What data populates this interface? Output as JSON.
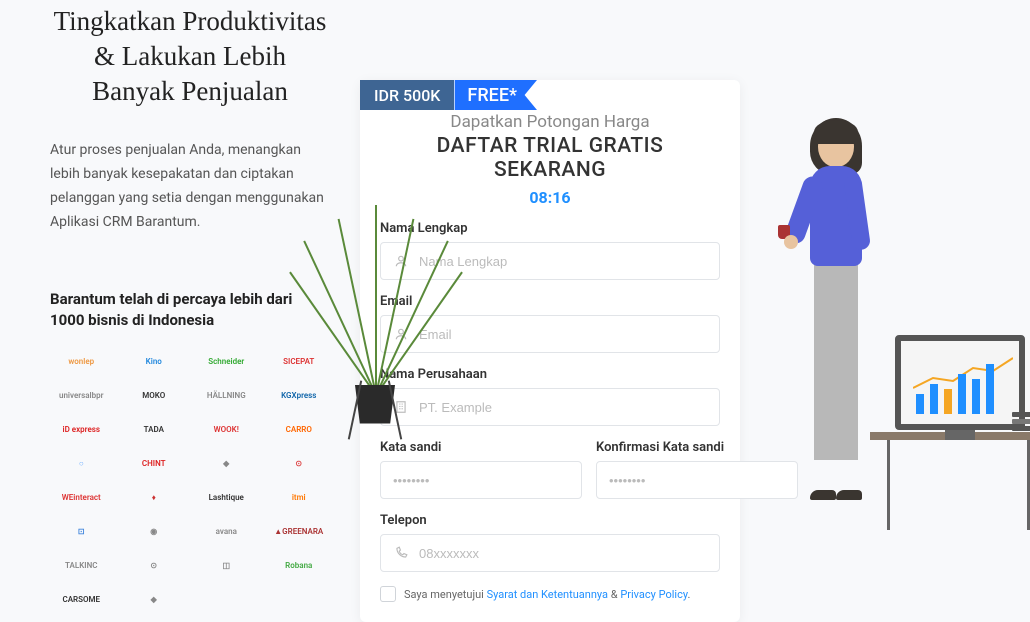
{
  "left": {
    "headline": "Tingkatkan Produktivitas & Lakukan Lebih Banyak Penjualan",
    "subtext": "Atur proses penjualan Anda, menangkan lebih banyak kesepakatan dan ciptakan pelanggan yang setia dengan menggunakan Aplikasi CRM Barantum.",
    "trusted": "Barantum telah di percaya lebih dari 1000 bisnis di Indonesia",
    "logos": [
      {
        "text": "wonlep",
        "color": "#e94"
      },
      {
        "text": "Kino",
        "color": "#28d"
      },
      {
        "text": "Schneider",
        "color": "#3a3"
      },
      {
        "text": "SICEPAT",
        "color": "#d33"
      },
      {
        "text": "universalbpr",
        "color": "#888"
      },
      {
        "text": "MOKO",
        "color": "#333"
      },
      {
        "text": "HÄLLNING",
        "color": "#888"
      },
      {
        "text": "KGXpress",
        "color": "#16a"
      },
      {
        "text": "iD express",
        "color": "#d22"
      },
      {
        "text": "TADA",
        "color": "#333"
      },
      {
        "text": "WOOK!",
        "color": "#d33"
      },
      {
        "text": "CARRO",
        "color": "#f60"
      },
      {
        "text": "○",
        "color": "#6af"
      },
      {
        "text": "CHINT",
        "color": "#d22"
      },
      {
        "text": "◆",
        "color": "#888"
      },
      {
        "text": "⊙",
        "color": "#d44"
      },
      {
        "text": "WEinteract",
        "color": "#d33"
      },
      {
        "text": "♦",
        "color": "#c33"
      },
      {
        "text": "Lashtique",
        "color": "#333"
      },
      {
        "text": "itmi",
        "color": "#f70"
      },
      {
        "text": "⊡",
        "color": "#48d"
      },
      {
        "text": "◉",
        "color": "#888"
      },
      {
        "text": "avana",
        "color": "#888"
      },
      {
        "text": "▲GREENARA",
        "color": "#a33"
      },
      {
        "text": "TALKINC",
        "color": "#888"
      },
      {
        "text": "⊙",
        "color": "#888"
      },
      {
        "text": "◫",
        "color": "#888"
      },
      {
        "text": "Robana",
        "color": "#4a4"
      },
      {
        "text": "CARSOME",
        "color": "#333"
      },
      {
        "text": "◆",
        "color": "#888"
      }
    ]
  },
  "form": {
    "price_old": "IDR 500K",
    "price_new": "FREE*",
    "subtitle": "Dapatkan Potongan Harga",
    "title": "DAFTAR TRIAL GRATIS SEKARANG",
    "timer": "08:16",
    "fields": {
      "name_label": "Nama Lengkap",
      "name_placeholder": "Nama Lengkap",
      "email_label": "Email",
      "email_placeholder": "Email",
      "company_label": "Nama Perusahaan",
      "company_placeholder": "PT. Example",
      "password_label": "Kata sandi",
      "password_placeholder": "••••••••",
      "confirm_label": "Konfirmasi Kata sandi",
      "confirm_placeholder": "••••••••",
      "phone_label": "Telepon",
      "phone_placeholder": "08xxxxxxx"
    },
    "consent_prefix": "Saya menyetujui ",
    "consent_link1": "Syarat dan Ketentuannya",
    "consent_amp": " & ",
    "consent_link2": "Privacy Policy",
    "consent_suffix": "."
  }
}
